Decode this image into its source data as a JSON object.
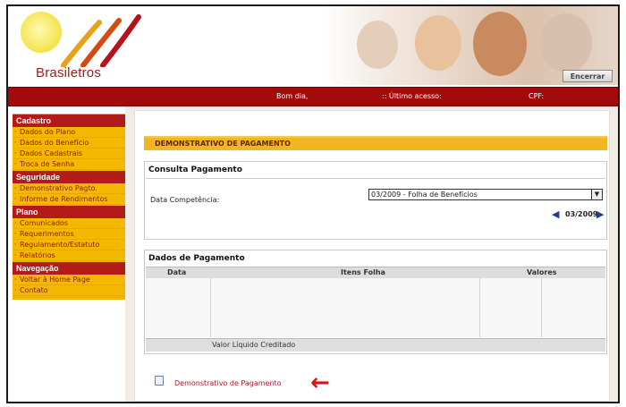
{
  "header": {
    "brand": "Brasiletros",
    "exit_label": "Encerrar"
  },
  "topbar": {
    "greeting": "Bom dia,",
    "last_access": ":: Último acesso:",
    "cpf": "CPF:"
  },
  "sidebar": {
    "sections": [
      {
        "title": "Cadastro",
        "items": [
          "Dados do Plano",
          "Dados do Benefício",
          "Dados Cadastrais",
          "Troca de Senha"
        ]
      },
      {
        "title": "Seguridade",
        "items": [
          "Demonstrativo Pagto.",
          "Informe de Rendimentos"
        ]
      },
      {
        "title": "Plano",
        "items": [
          "Comunicados",
          "Requerimentos",
          "Regulamento/Estatuto",
          "Relatórios"
        ]
      },
      {
        "title": "Navegação",
        "items": [
          "Voltar à Home Page",
          "Contato"
        ]
      }
    ]
  },
  "main": {
    "banner_title": "DEMONSTRATIVO DE PAGAMENTO",
    "consulta": {
      "title": "Consulta Pagamento",
      "field_label": "Data Competência:",
      "select_value": "03/2009 - Folha de Benefícios",
      "period": "03/2009"
    },
    "dados": {
      "title": "Dados de Pagamento",
      "columns": [
        "Data",
        "Itens Folha",
        "Valores"
      ],
      "footer": "Valor Líquido Creditado"
    },
    "doc_link": "Demonstrativo de Pagamento"
  },
  "colors": {
    "brand_red": "#a30b0b",
    "menu_yellow": "#f5b800",
    "section_red": "#b31b1b",
    "annotation_arrow": "#d7141a"
  }
}
